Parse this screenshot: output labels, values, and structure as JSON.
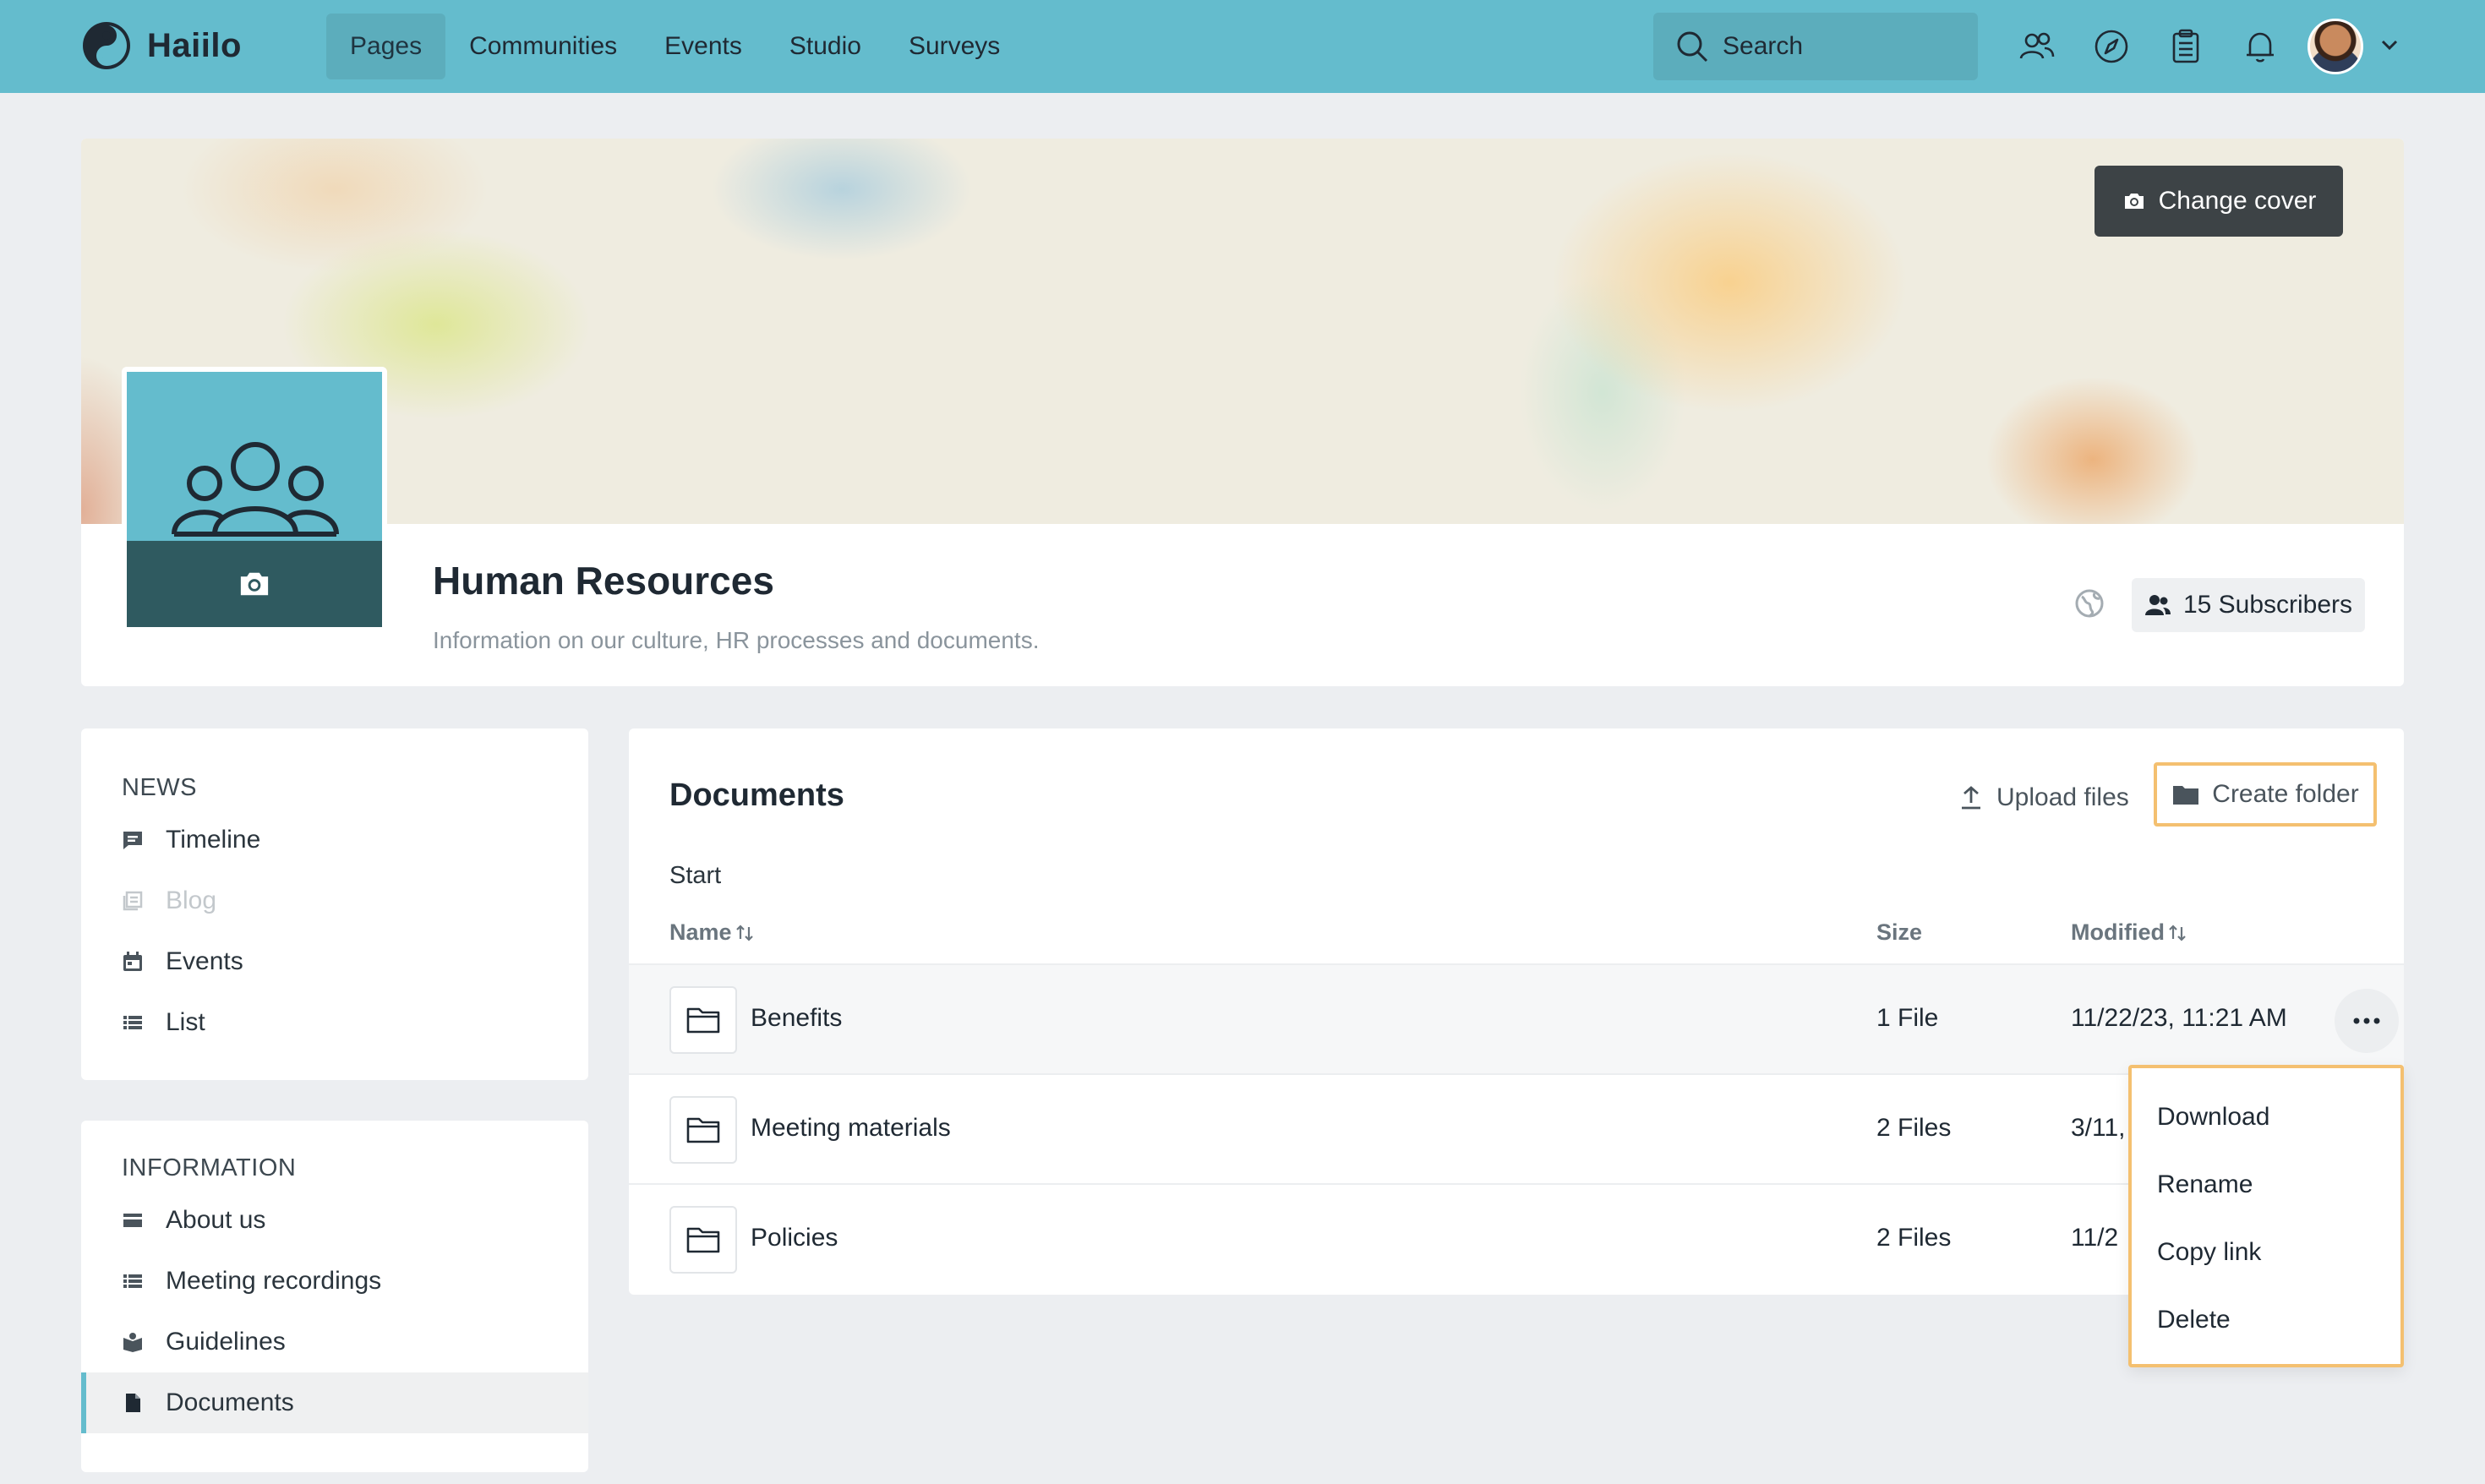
{
  "app": {
    "name": "Haiilo"
  },
  "nav": {
    "items": [
      {
        "label": "Pages",
        "active": true
      },
      {
        "label": "Communities",
        "active": false
      },
      {
        "label": "Events",
        "active": false
      },
      {
        "label": "Studio",
        "active": false
      },
      {
        "label": "Surveys",
        "active": false
      }
    ],
    "search_placeholder": "Search",
    "icons": [
      "people-icon",
      "compass-icon",
      "clipboard-icon",
      "bell-icon"
    ]
  },
  "header": {
    "change_cover": "Change cover",
    "title": "Human Resources",
    "description": "Information on our culture, HR processes and documents.",
    "subscribers": "15 Subscribers"
  },
  "sidebar": {
    "news_heading": "NEWS",
    "news_items": [
      {
        "label": "Timeline",
        "icon": "timeline-icon",
        "disabled": false
      },
      {
        "label": "Blog",
        "icon": "blog-icon",
        "disabled": true
      },
      {
        "label": "Events",
        "icon": "calendar-icon",
        "disabled": false
      },
      {
        "label": "List",
        "icon": "list-icon",
        "disabled": false
      }
    ],
    "info_heading": "INFORMATION",
    "info_items": [
      {
        "label": "About us",
        "icon": "card-icon",
        "active": false
      },
      {
        "label": "Meeting recordings",
        "icon": "list-icon",
        "active": false
      },
      {
        "label": "Guidelines",
        "icon": "book-icon",
        "active": false
      },
      {
        "label": "Documents",
        "icon": "document-icon",
        "active": true
      }
    ]
  },
  "documents": {
    "title": "Documents",
    "upload_label": "Upload files",
    "create_folder_label": "Create folder",
    "breadcrumb": "Start",
    "columns": {
      "name": "Name",
      "size": "Size",
      "modified": "Modified"
    },
    "rows": [
      {
        "name": "Benefits",
        "size": "1 File",
        "modified": "11/22/23, 11:21 AM"
      },
      {
        "name": "Meeting materials",
        "size": "2 Files",
        "modified": "3/11,"
      },
      {
        "name": "Policies",
        "size": "2 Files",
        "modified": "11/2"
      }
    ]
  },
  "context_menu": {
    "items": [
      "Download",
      "Rename",
      "Copy link",
      "Delete"
    ]
  },
  "colors": {
    "brand": "#64bccd",
    "highlight": "#f4c070",
    "dark_button": "#3d4346"
  }
}
